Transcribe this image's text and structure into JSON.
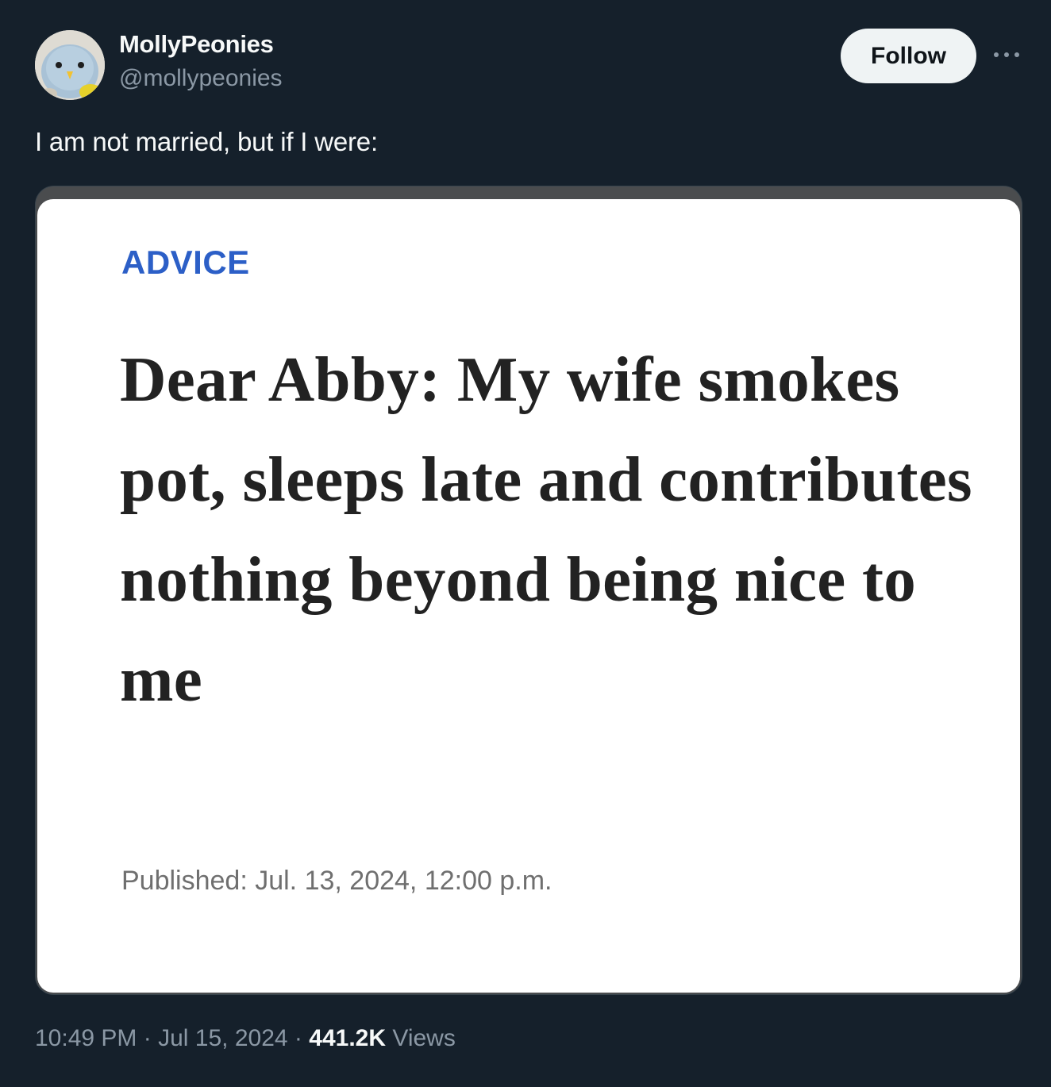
{
  "author": {
    "display_name": "MollyPeonies",
    "handle": "@mollypeonies",
    "avatar_icon": "crochet-bird-avatar"
  },
  "actions": {
    "follow_label": "Follow",
    "more_icon": "more-horizontal-icon"
  },
  "tweet": {
    "text": "I am not married, but if I were:"
  },
  "media": {
    "category": "ADVICE",
    "headline": "Dear Abby: My wife smokes pot, sleeps late and contributes nothing beyond being nice to me",
    "published": "Published: Jul. 13, 2024, 12:00 p.m."
  },
  "meta": {
    "time": "10:49 PM",
    "separator": "·",
    "date": "Jul 15, 2024",
    "views_count": "441.2K",
    "views_label": "Views"
  },
  "colors": {
    "background": "#15202b",
    "text_primary": "#f7f9f9",
    "text_secondary": "#8b98a5",
    "follow_button_bg": "#eff3f4",
    "category_blue": "#2c5fc7",
    "headline": "#222222"
  }
}
